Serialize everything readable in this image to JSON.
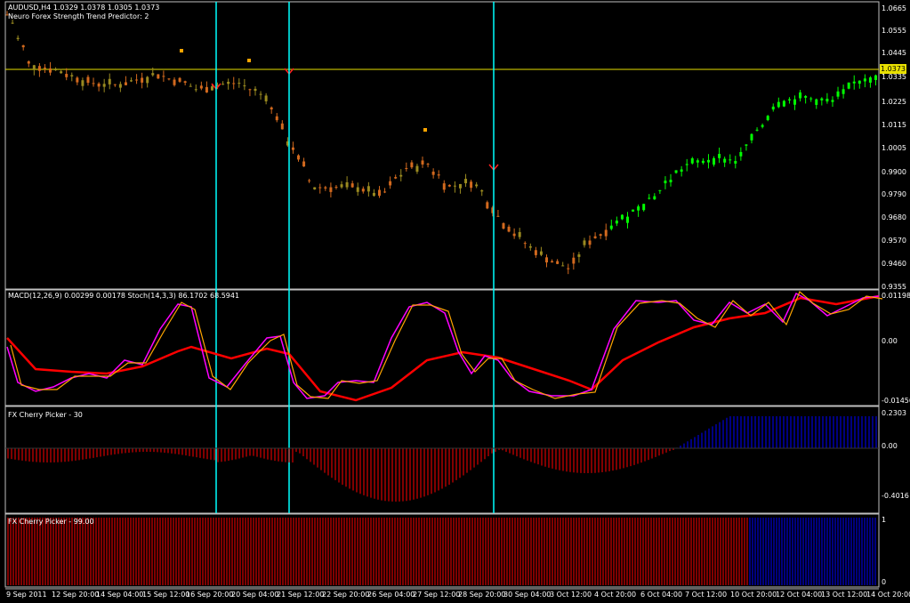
{
  "main_pane": {
    "symbol_line": "AUDUSD,H4  1.0329 1.0378 1.0305 1.0373",
    "indicator_line": "Neuro Forex Strength Trend Predictor: 2",
    "current_price": "1.0373",
    "price_ticks": [
      "1.0665",
      "1.0555",
      "1.0445",
      "1.0335",
      "1.0225",
      "1.0115",
      "1.0005",
      "0.9900",
      "0.9790",
      "0.9680",
      "0.9570",
      "0.9460",
      "0.9355"
    ]
  },
  "macd_pane": {
    "title": "MACD(12,26,9) 0.00299 0.00178  Stoch(14,3,3) 86.1702 68.5941",
    "ticks": [
      "0.01198",
      "0.00",
      "-0.01456"
    ]
  },
  "cherry30_pane": {
    "title": "FX Cherry Picker - 30",
    "ticks": [
      "0.2303",
      "0.00",
      "-0.4016"
    ]
  },
  "cherry99_pane": {
    "title": "FX Cherry Picker - 99.00",
    "ticks": [
      "1",
      "0"
    ]
  },
  "date_axis": [
    "9 Sep 2011",
    "12 Sep 20:00",
    "14 Sep 04:00",
    "15 Sep 12:00",
    "16 Sep 20:00",
    "20 Sep 04:00",
    "21 Sep 12:00",
    "22 Sep 20:00",
    "26 Sep 04:00",
    "27 Sep 12:00",
    "28 Sep 20:00",
    "30 Sep 04:00",
    "3 Oct 12:00",
    "4 Oct 20:00",
    "6 Oct 04:00",
    "7 Oct 12:00",
    "10 Oct 20:00",
    "12 Oct 04:00",
    "13 Oct 12:00",
    "14 Oct 20:00"
  ],
  "colors": {
    "background": "#000000",
    "bear_candle": "#d2691e",
    "bull_candle": "#00ff00",
    "signal_line": "#00ffff",
    "macd_main": "#ff0000",
    "stoch_main": "#ff00ff",
    "stoch_signal": "#ffa500",
    "histogram_neg": "#ff0000",
    "histogram_pos": "#0000ff",
    "price_line": "#e8e000"
  }
}
